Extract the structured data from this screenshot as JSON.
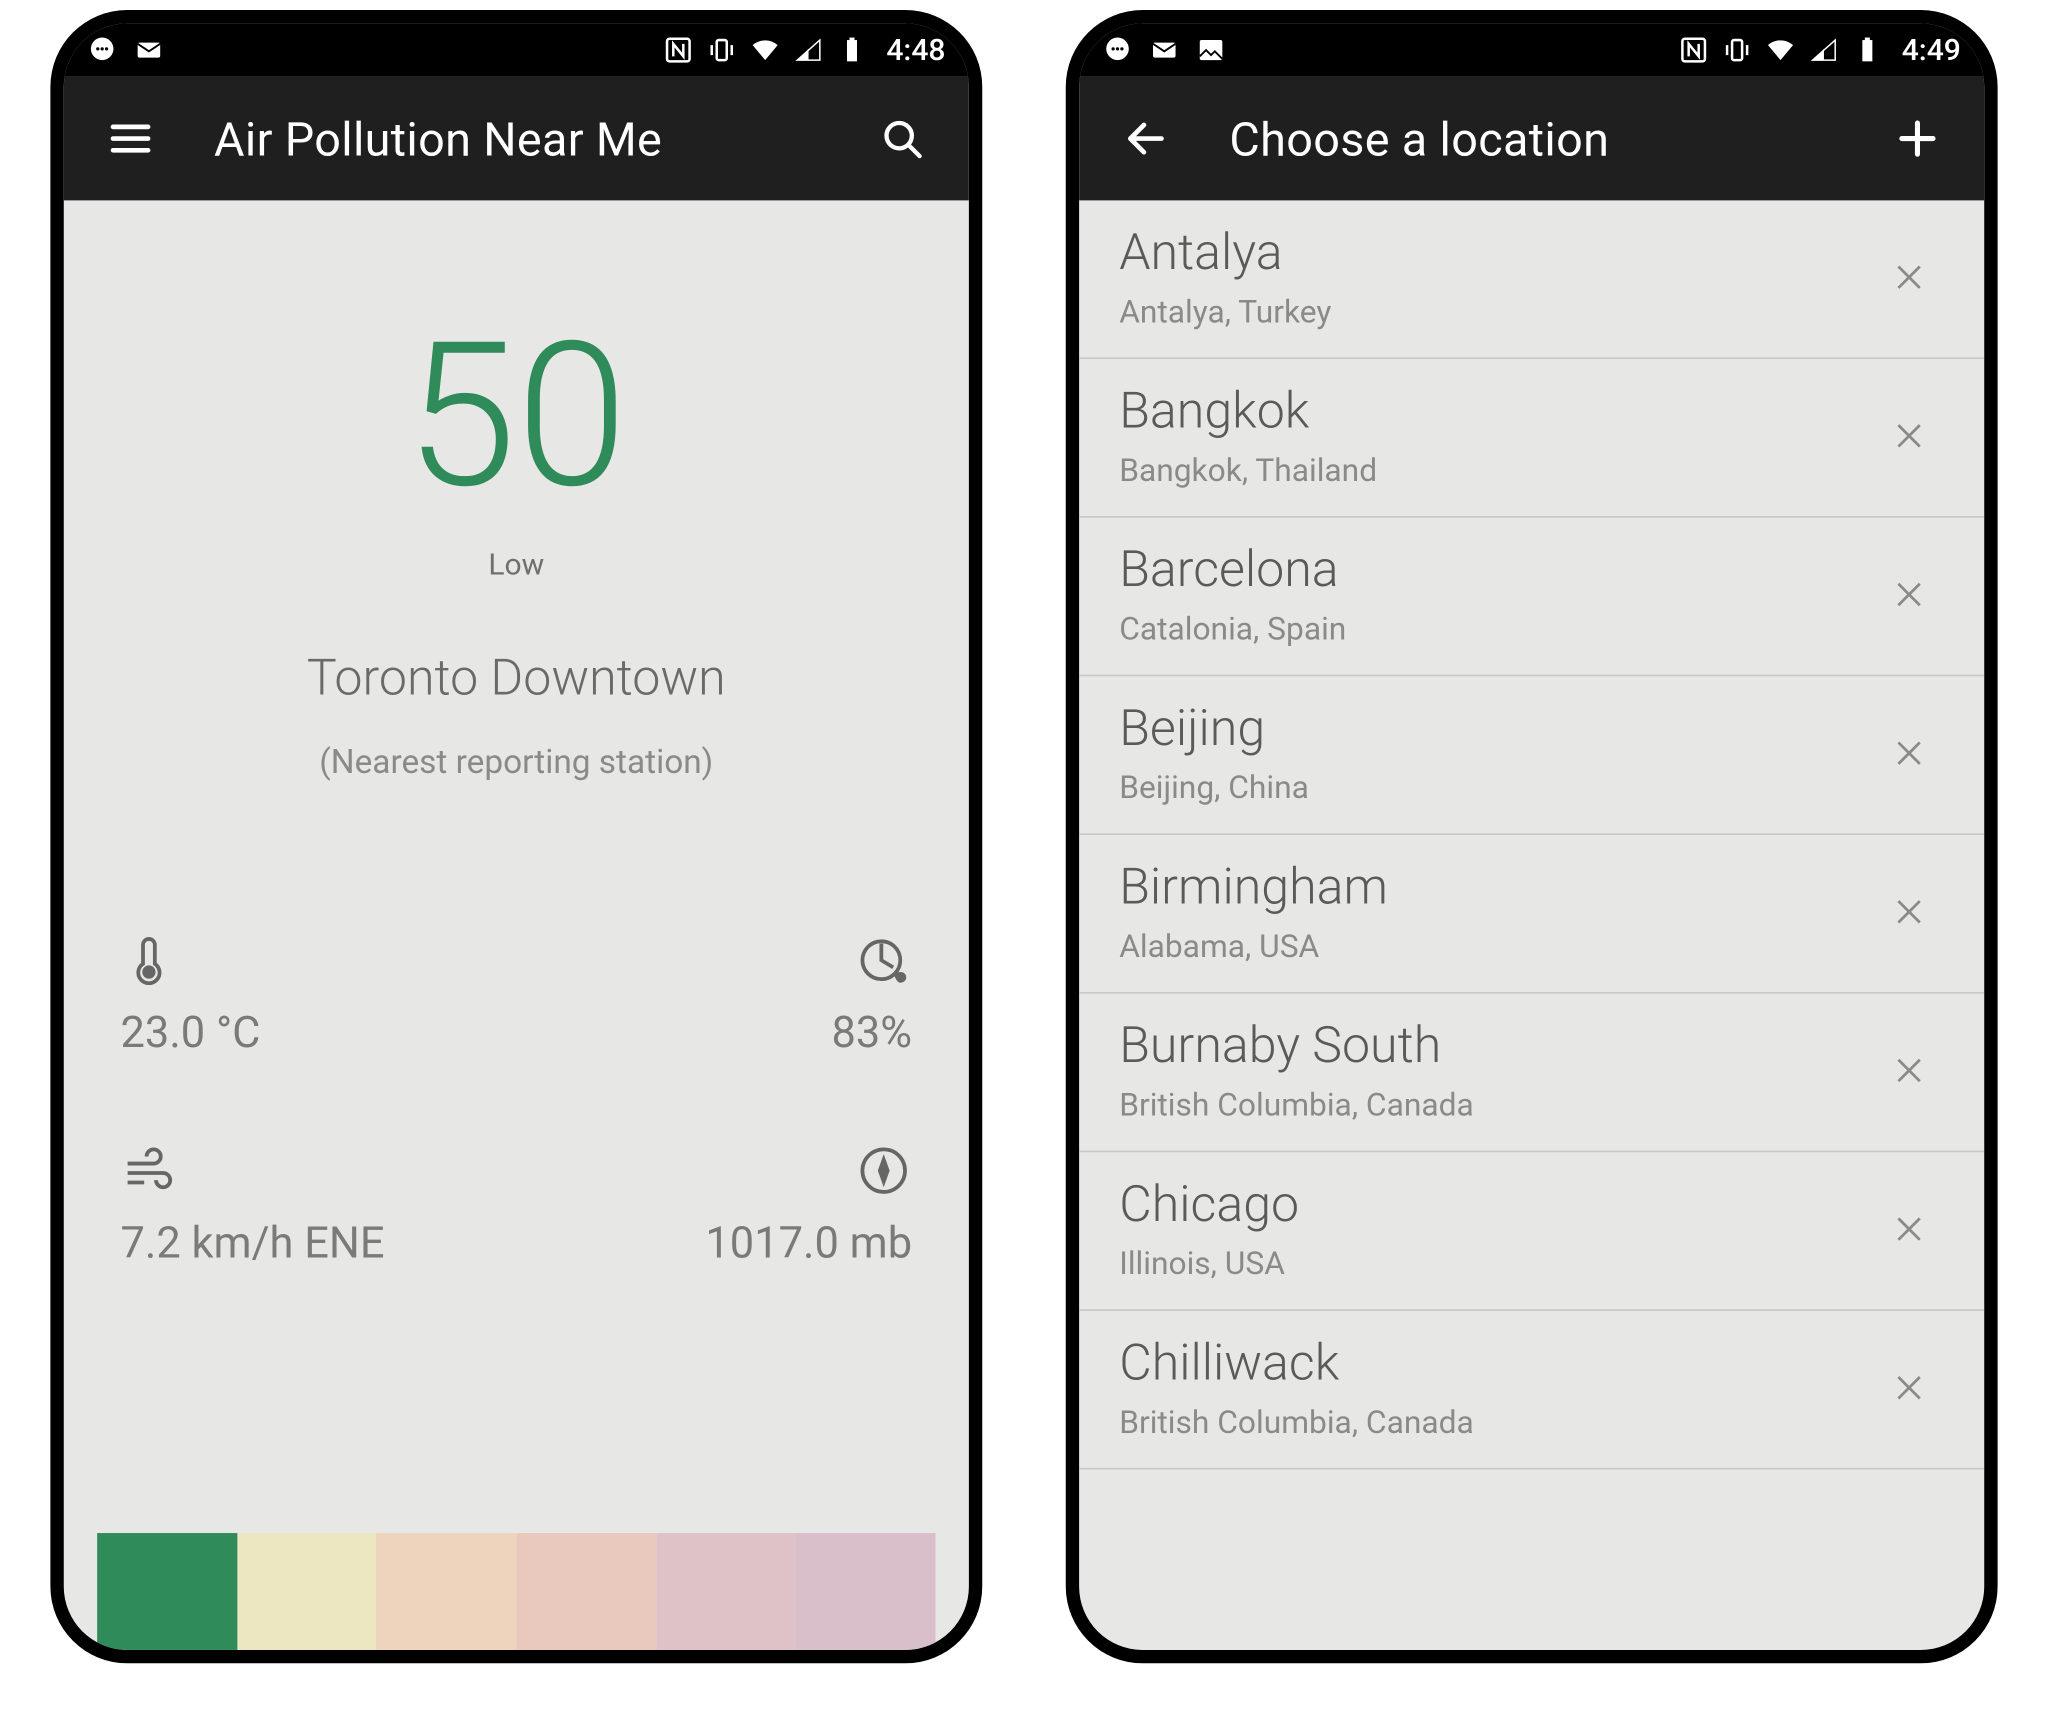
{
  "colors": {
    "aqi_green": "#2f8c5a",
    "scale": [
      "#2f8c5a",
      "#ece7c1",
      "#eed4bd",
      "#e9c9be",
      "#dfc1c8",
      "#d9bfc9"
    ]
  },
  "screen1": {
    "statusbar": {
      "time": "4:48"
    },
    "appbar": {
      "title": "Air Pollution Near Me"
    },
    "aqi": {
      "value": "50",
      "level": "Low",
      "station": "Toronto Downtown",
      "note": "(Nearest reporting station)"
    },
    "stats": {
      "temperature": "23.0 °C",
      "humidity": "83%",
      "wind": "7.2 km/h ENE",
      "pressure": "1017.0 mb"
    }
  },
  "screen2": {
    "statusbar": {
      "time": "4:49"
    },
    "appbar": {
      "title": "Choose a location"
    },
    "locations": [
      {
        "city": "Antalya",
        "region": "Antalya, Turkey"
      },
      {
        "city": "Bangkok",
        "region": "Bangkok, Thailand"
      },
      {
        "city": "Barcelona",
        "region": "Catalonia, Spain"
      },
      {
        "city": "Beijing",
        "region": "Beijing, China"
      },
      {
        "city": "Birmingham",
        "region": "Alabama, USA"
      },
      {
        "city": "Burnaby South",
        "region": "British Columbia, Canada"
      },
      {
        "city": "Chicago",
        "region": "Illinois, USA"
      },
      {
        "city": "Chilliwack",
        "region": "British Columbia, Canada"
      }
    ]
  }
}
